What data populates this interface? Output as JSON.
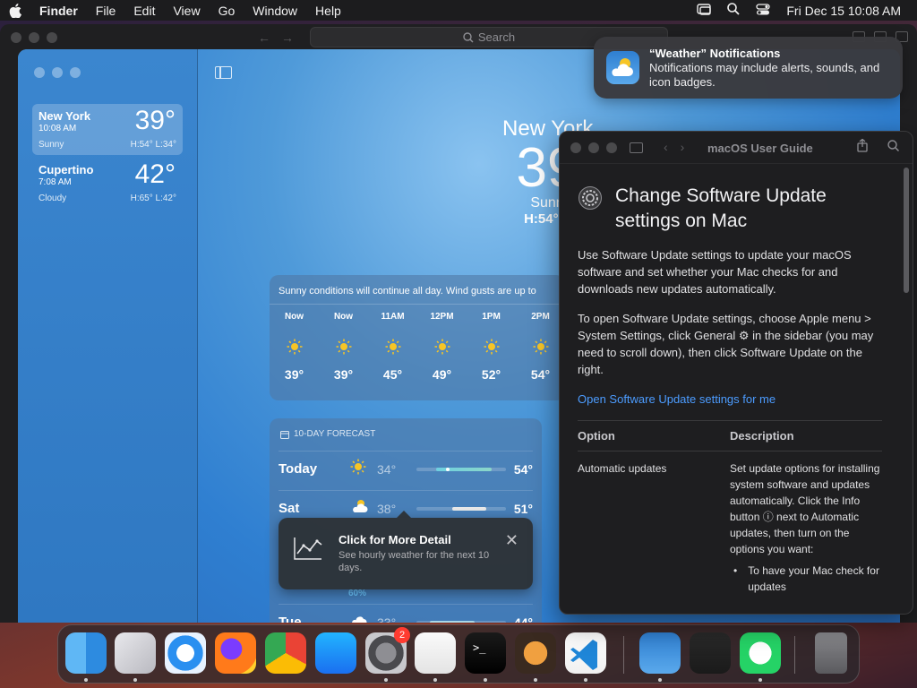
{
  "menubar": {
    "app_name": "Finder",
    "menus": [
      "File",
      "Edit",
      "View",
      "Go",
      "Window",
      "Help"
    ],
    "clock": "Fri Dec 15  10:08 AM"
  },
  "finder": {
    "search_placeholder": "Search"
  },
  "weather": {
    "locations": [
      {
        "city": "New York",
        "time": "10:08 AM",
        "temp": "39°",
        "condition": "Sunny",
        "hl": "H:54°  L:34°",
        "selected": true
      },
      {
        "city": "Cupertino",
        "time": "7:08 AM",
        "temp": "42°",
        "condition": "Cloudy",
        "hl": "H:65°  L:42°",
        "selected": false
      }
    ],
    "hero": {
      "city": "New York",
      "temp": "39",
      "condition": "Sunn",
      "hl": "H:54°  L"
    },
    "hourly_summary": "Sunny conditions will continue all day. Wind gusts are up to",
    "hourly": [
      {
        "label": "Now",
        "temp": "39°"
      },
      {
        "label": "Now",
        "temp": "39°"
      },
      {
        "label": "11AM",
        "temp": "45°"
      },
      {
        "label": "12PM",
        "temp": "49°"
      },
      {
        "label": "1PM",
        "temp": "52°"
      },
      {
        "label": "2PM",
        "temp": "54°"
      }
    ],
    "forecast_header": "10-DAY FORECAST",
    "forecast": [
      {
        "day": "Today",
        "low": "34°",
        "high": "54°"
      },
      {
        "day": "Sat",
        "low": "38°",
        "high": "51°"
      },
      {
        "day": "Tue",
        "low": "33°",
        "high": "44°"
      }
    ],
    "precip": "60%",
    "tooltip": {
      "title": "Click for More Detail",
      "subtitle": "See hourly weather for the next 10 days."
    }
  },
  "notification": {
    "title": "“Weather” Notifications",
    "body": "Notifications may include alerts, sounds, and icon badges."
  },
  "help": {
    "window_title": "macOS User Guide",
    "heading": "Change Software Update settings on Mac",
    "para1": "Use Software Update settings to update your macOS software and set whether your Mac checks for and downloads new updates automatically.",
    "para2": "To open Software Update settings, choose Apple menu  > System Settings, click General ⚙ in the sidebar (you may need to scroll down), then click Software Update on the right.",
    "link": "Open Software Update settings for me",
    "col_option": "Option",
    "col_description": "Description",
    "row_option": "Automatic updates",
    "row_description": "Set update options for installing system software and updates automatically. Click the Info button ⓘ next to Automatic updates, then turn on the options you want:",
    "bullet": "To have your Mac check for updates"
  },
  "dock": {
    "apps": [
      "Finder",
      "Launchpad",
      "Safari",
      "Firefox",
      "Chrome",
      "App Store",
      "System Settings",
      "TextEdit",
      "Terminal",
      "GarageBand",
      "Visual Studio Code",
      "Weather",
      "Voice Memos",
      "WhatsApp",
      "Trash"
    ],
    "settings_badge": "2"
  }
}
